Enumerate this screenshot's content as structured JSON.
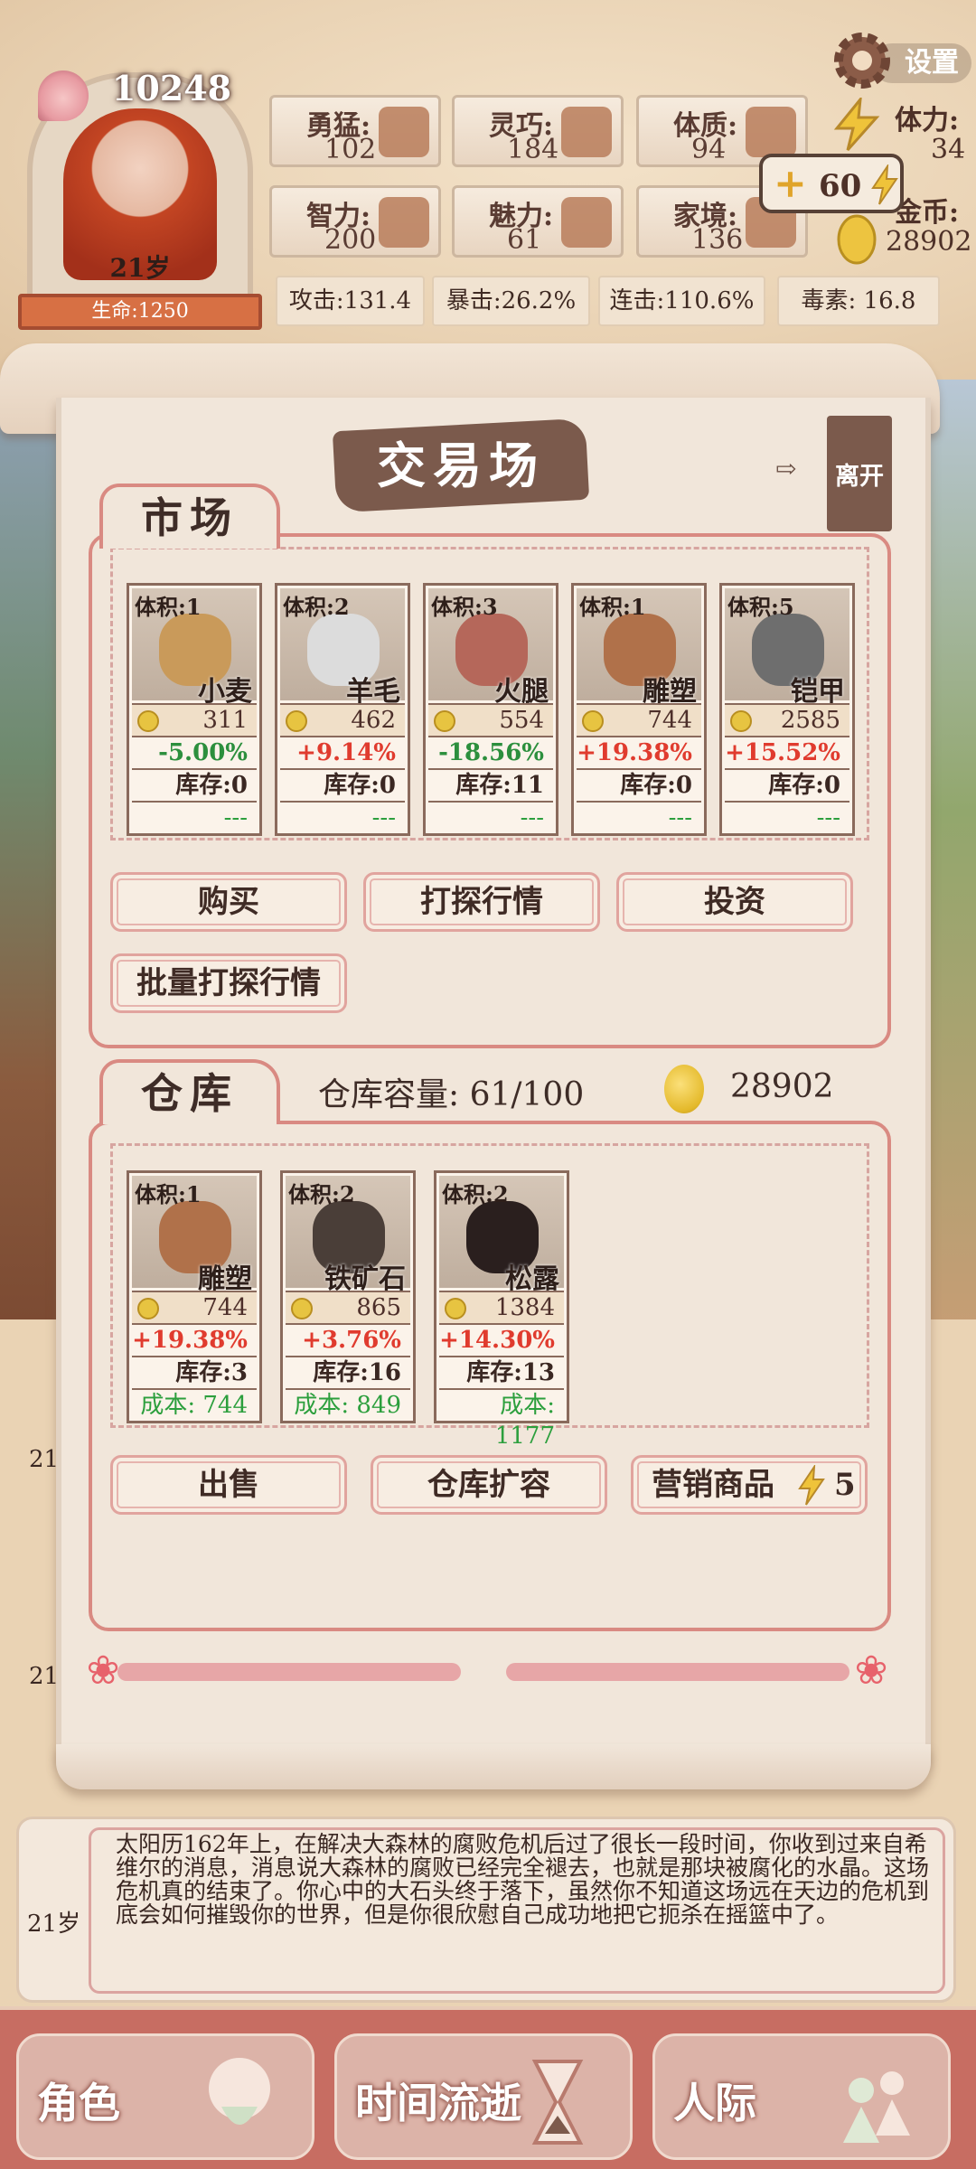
{
  "header": {
    "score": "10248",
    "age_badge": "21岁",
    "hp_label": "生命:1250",
    "settings_label": "设置",
    "energy_label": "体力:",
    "energy_value": "34",
    "coin_label": "金币:",
    "coin_value": "28902",
    "energy_plus": {
      "plus": "+",
      "value": "60"
    },
    "stats": [
      {
        "label": "勇猛:",
        "value": "102",
        "icon": "fist-icon"
      },
      {
        "label": "灵巧:",
        "value": "184",
        "icon": "cloak-icon"
      },
      {
        "label": "体质:",
        "value": "94",
        "icon": "arm-icon"
      },
      {
        "label": "智力:",
        "value": "200",
        "icon": "brain-icon"
      },
      {
        "label": "魅力:",
        "value": "61",
        "icon": "flower-icon"
      },
      {
        "label": "家境:",
        "value": "136",
        "icon": "house-icon"
      }
    ],
    "combat": [
      "攻击:131.4",
      "暴击:26.2%",
      "连击:110.6%",
      "毒素: 16.8"
    ]
  },
  "trade": {
    "title": "交易场",
    "leave_label": "离开",
    "market_tab": "市场",
    "warehouse_tab": "仓库",
    "market_items": [
      {
        "volume": "体积:1",
        "name": "小麦",
        "price": "311",
        "change": "-5.00%",
        "dir": "neg",
        "stock": "库存:0",
        "cost": "---"
      },
      {
        "volume": "体积:2",
        "name": "羊毛",
        "price": "462",
        "change": "+9.14%",
        "dir": "pos",
        "stock": "库存:0",
        "cost": "---"
      },
      {
        "volume": "体积:3",
        "name": "火腿",
        "price": "554",
        "change": "-18.56%",
        "dir": "neg",
        "stock": "库存:11",
        "cost": "---"
      },
      {
        "volume": "体积:1",
        "name": "雕塑",
        "price": "744",
        "change": "+19.38%",
        "dir": "pos",
        "stock": "库存:0",
        "cost": "---"
      },
      {
        "volume": "体积:5",
        "name": "铠甲",
        "price": "2585",
        "change": "+15.52%",
        "dir": "pos",
        "stock": "库存:0",
        "cost": "---"
      }
    ],
    "market_buttons": {
      "buy": "购买",
      "scout": "打探行情",
      "invest": "投资",
      "batch_scout": "批量打探行情"
    },
    "warehouse_capacity": "仓库容量: 61/100",
    "warehouse_gold": "28902",
    "warehouse_items": [
      {
        "volume": "体积:1",
        "name": "雕塑",
        "price": "744",
        "change": "+19.38%",
        "dir": "pos",
        "stock": "库存:3",
        "cost": "成本: 744"
      },
      {
        "volume": "体积:2",
        "name": "铁矿石",
        "price": "865",
        "change": "+3.76%",
        "dir": "pos",
        "stock": "库存:16",
        "cost": "成本: 849"
      },
      {
        "volume": "体积:2",
        "name": "松露",
        "price": "1384",
        "change": "+14.30%",
        "dir": "pos",
        "stock": "库存:13",
        "cost": "成本: 1177"
      }
    ],
    "warehouse_buttons": {
      "sell": "出售",
      "expand": "仓库扩容",
      "marketing": "营销商品",
      "marketing_cost": "5"
    }
  },
  "log": {
    "age": "21岁",
    "side_ages": [
      "21",
      "21"
    ],
    "text": "太阳历162年上，在解决大森林的腐败危机后过了很长一段时间，你收到过来自希维尔的消息，消息说大森林的腐败已经完全褪去，也就是那块被腐化的水晶。这场危机真的结束了。你心中的大石头终于落下，虽然你不知道这场远在天边的危机到底会如何摧毁你的世界，但是你很欣慰自己成功地把它扼杀在摇篮中了。"
  },
  "nav": [
    {
      "label": "角色",
      "icon": "character-icon"
    },
    {
      "label": "时间流逝",
      "icon": "hourglass-icon"
    },
    {
      "label": "人际",
      "icon": "people-icon"
    }
  ],
  "colors": {
    "accent": "#d98a82",
    "positive": "#e03b2e",
    "negative": "#2c8f3d",
    "nav_bg": "#c76d62"
  }
}
